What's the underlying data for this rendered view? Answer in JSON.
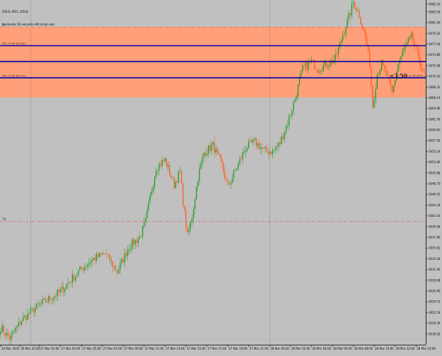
{
  "header": {
    "symbol_line": "GOLD, M15, GOLD",
    "timer_line": "0 minutes 50 seconds left to bar end"
  },
  "countdown": "<3:50",
  "chart_data": {
    "type": "candlestick",
    "symbol": "GOLD",
    "timeframe": "M15",
    "ylim": [
      3016.0,
      3086.0
    ],
    "grid": false,
    "colors": {
      "background": "#c0c0c0",
      "bull": "#1e9a1e",
      "bear": "#ff5a1e",
      "zone": "#ffa07a",
      "level_line": "#0000aa",
      "dashed_line": "#e05050",
      "price_tag": "#1e50c8"
    },
    "y_ticks": [
      "3085.16",
      "3083.58",
      "3081.40",
      "3079.22",
      "3077.04",
      "3074.86",
      "3072.68",
      "3070.50",
      "3068.32",
      "3066.14",
      "3063.96",
      "3061.78",
      "3059.60",
      "3057.42",
      "3055.24",
      "3053.06",
      "3050.88",
      "3048.70",
      "3046.52",
      "3044.34",
      "3042.16",
      "3039.98",
      "3037.80",
      "3035.62",
      "3033.44",
      "3031.26",
      "3029.08",
      "3026.90",
      "3024.72",
      "3022.54",
      "3020.36",
      "3018.18"
    ],
    "x_ticks": [
      {
        "i": 0,
        "label": "26 Mar 2025"
      },
      {
        "i": 13,
        "label": "26 Mar 22:00"
      },
      {
        "i": 26,
        "label": "27 Mar 01:00"
      },
      {
        "i": 40,
        "label": "27 Mar 03:00"
      },
      {
        "i": 54,
        "label": "27 Mar 05:00"
      },
      {
        "i": 68,
        "label": "27 Mar 07:00"
      },
      {
        "i": 82,
        "label": "27 Mar 09:00"
      },
      {
        "i": 96,
        "label": "27 Mar 11:00"
      },
      {
        "i": 110,
        "label": "27 Mar 13:00"
      },
      {
        "i": 124,
        "label": "27 Mar 15:00"
      },
      {
        "i": 138,
        "label": "27 Mar 17:00"
      },
      {
        "i": 152,
        "label": "27 Mar 19:00"
      },
      {
        "i": 166,
        "label": "27 Mar 21:00"
      },
      {
        "i": 180,
        "label": "28 Mar 00:00"
      },
      {
        "i": 194,
        "label": "28 Mar 02:00"
      },
      {
        "i": 208,
        "label": "28 Mar 04:00"
      },
      {
        "i": 222,
        "label": "28 Mar 06:00"
      },
      {
        "i": 236,
        "label": "28 Mar 08:00"
      },
      {
        "i": 250,
        "label": "28 Mar 10:00"
      },
      {
        "i": 264,
        "label": "28 Mar 12:00"
      },
      {
        "i": 278,
        "label": "28 Mar 14:00"
      }
    ],
    "vertical_markers": [
      20,
      180
    ],
    "zones": [
      {
        "top": 3080.5,
        "bottom": 3066.2
      }
    ],
    "dashed_levels": [
      {
        "price": 3080.5,
        "label": "IN"
      },
      {
        "price": 3041.0,
        "label": "TD"
      }
    ],
    "levels": [
      {
        "price": 3076.73,
        "label": "INTL.HI @ 3076.47",
        "tag": "3076.73"
      },
      {
        "price": 3073.5,
        "label": "",
        "tag": "3073.50"
      },
      {
        "price": 3070.2,
        "label": "INTL.HI @ 3070.21",
        "tag": "3070.21"
      }
    ],
    "current_tag": {
      "price": 3070.2,
      "note": "3070.21 @ 3071.21 10:00"
    },
    "anchors": [
      [
        0,
        3019.5
      ],
      [
        6,
        3017.3
      ],
      [
        14,
        3021.0
      ],
      [
        22,
        3023.2
      ],
      [
        30,
        3024.9
      ],
      [
        40,
        3026.8
      ],
      [
        48,
        3029.5
      ],
      [
        55,
        3031.7
      ],
      [
        62,
        3033.4
      ],
      [
        70,
        3034.5
      ],
      [
        78,
        3030.8
      ],
      [
        86,
        3036.0
      ],
      [
        93,
        3037.8
      ],
      [
        97,
        3041.0
      ],
      [
        100,
        3046.0
      ],
      [
        104,
        3052.0
      ],
      [
        110,
        3053.5
      ],
      [
        116,
        3048.5
      ],
      [
        120,
        3051.0
      ],
      [
        122,
        3045.0
      ],
      [
        125,
        3038.0
      ],
      [
        128,
        3042.0
      ],
      [
        132,
        3050.0
      ],
      [
        136,
        3055.0
      ],
      [
        142,
        3056.5
      ],
      [
        148,
        3052.5
      ],
      [
        152,
        3048.0
      ],
      [
        158,
        3052.0
      ],
      [
        164,
        3056.0
      ],
      [
        170,
        3057.2
      ],
      [
        176,
        3055.5
      ],
      [
        182,
        3055.2
      ],
      [
        187,
        3057.0
      ],
      [
        192,
        3061.0
      ],
      [
        197,
        3066.0
      ],
      [
        202,
        3072.0
      ],
      [
        208,
        3073.5
      ],
      [
        212,
        3072.0
      ],
      [
        218,
        3073.0
      ],
      [
        224,
        3074.0
      ],
      [
        229,
        3079.0
      ],
      [
        233,
        3082.5
      ],
      [
        236,
        3085.5
      ],
      [
        240,
        3083.0
      ],
      [
        244,
        3078.5
      ],
      [
        247,
        3073.0
      ],
      [
        249,
        3064.5
      ],
      [
        252,
        3071.0
      ],
      [
        255,
        3073.0
      ],
      [
        259,
        3070.0
      ],
      [
        262,
        3067.0
      ],
      [
        266,
        3073.0
      ],
      [
        270,
        3076.0
      ],
      [
        275,
        3078.5
      ],
      [
        280,
        3074.0
      ],
      [
        283,
        3070.8
      ]
    ]
  }
}
